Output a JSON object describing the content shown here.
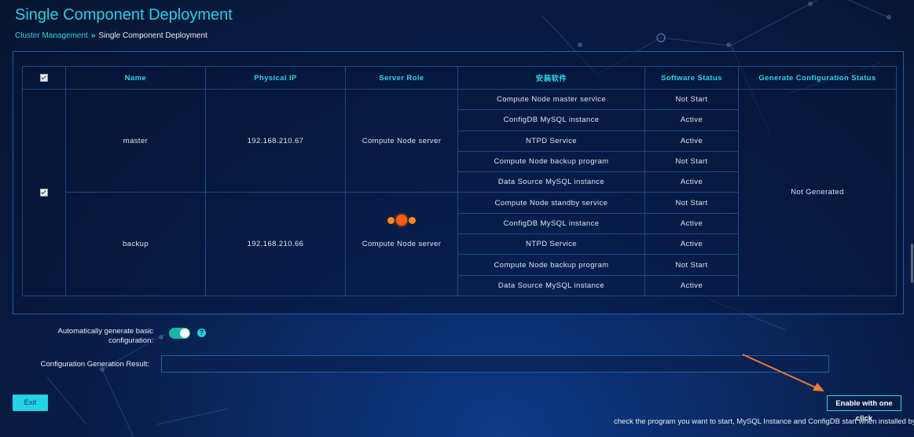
{
  "page": {
    "title": "Single Component Deployment",
    "breadcrumb": {
      "parent": "Cluster Management",
      "current": "Single Component Deployment"
    }
  },
  "table": {
    "headers": {
      "name": "Name",
      "physical_ip": "Physical IP",
      "server_role": "Server Role",
      "software": "安装软件",
      "software_status": "Software Status",
      "config_status": "Generate Configuration Status"
    },
    "servers": [
      {
        "name": "master",
        "ip": "192.168.210.67",
        "role": "Compute Node server",
        "software": [
          {
            "name": "Compute Node master service",
            "status": "Not Start"
          },
          {
            "name": "ConfigDB MySQL instance",
            "status": "Active"
          },
          {
            "name": "NTPD Service",
            "status": "Active"
          },
          {
            "name": "Compute Node backup program",
            "status": "Not Start"
          },
          {
            "name": "Data Source MySQL instance",
            "status": "Active"
          }
        ]
      },
      {
        "name": "backup",
        "ip": "192.168.210.66",
        "role": "Compute Node server",
        "software": [
          {
            "name": "Compute Node standby service",
            "status": "Not Start"
          },
          {
            "name": "ConfigDB MySQL instance",
            "status": "Active"
          },
          {
            "name": "NTPD Service",
            "status": "Active"
          },
          {
            "name": "Compute Node backup program",
            "status": "Not Start"
          },
          {
            "name": "Data Source MySQL instance",
            "status": "Active"
          }
        ]
      }
    ],
    "config_status": "Not Generated"
  },
  "form": {
    "auto_generate_label_line1": "Automatically generate basic",
    "auto_generate_label_line2": "configuration:",
    "auto_generate_on": true,
    "help_glyph": "?",
    "result_label": "Configuration Generation Result:",
    "result_value": ""
  },
  "buttons": {
    "exit": "Exit",
    "enable": "Enable with one click"
  },
  "hint": "check the program you want to start, MySQL Instance and ConfigDB start when installed by default",
  "colors": {
    "accent": "#22d3e6",
    "toggle": "#17b7a8",
    "arrow": "#f07a30"
  }
}
